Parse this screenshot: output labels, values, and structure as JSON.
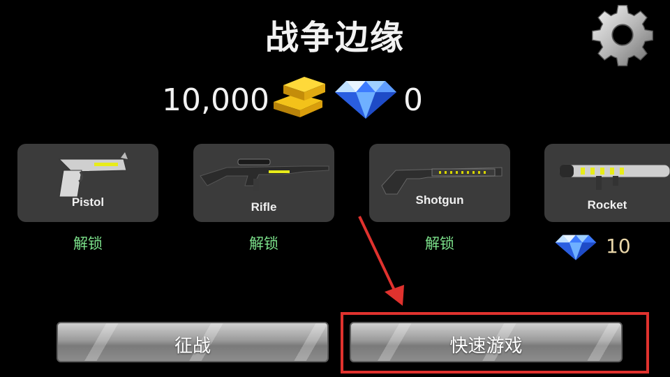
{
  "title": "战争边缘",
  "currency": {
    "gold": "10,000",
    "gems": "0"
  },
  "weapons": [
    {
      "name": "Pistol",
      "status": "解锁"
    },
    {
      "name": "Rifle",
      "status": "解锁"
    },
    {
      "name": "Shotgun",
      "status": "解锁"
    },
    {
      "name": "Rocket",
      "price": "10"
    }
  ],
  "buttons": {
    "campaign": "征战",
    "quick_play": "快速游戏"
  },
  "colors": {
    "unlock": "#7be08a",
    "highlight": "#e0322e",
    "card_bg": "#3b3b3b"
  },
  "icons": [
    "gear-icon",
    "gold-bar-icon",
    "diamond-icon",
    "pistol-icon",
    "rifle-icon",
    "shotgun-icon",
    "rocket-launcher-icon"
  ]
}
